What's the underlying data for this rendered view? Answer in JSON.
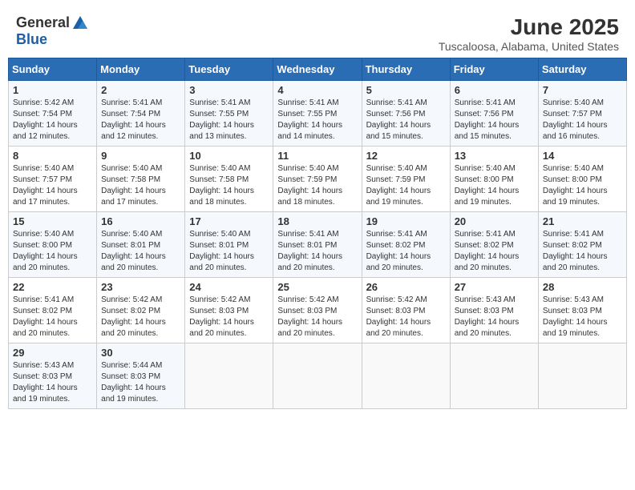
{
  "header": {
    "logo_general": "General",
    "logo_blue": "Blue",
    "title": "June 2025",
    "subtitle": "Tuscaloosa, Alabama, United States"
  },
  "weekdays": [
    "Sunday",
    "Monday",
    "Tuesday",
    "Wednesday",
    "Thursday",
    "Friday",
    "Saturday"
  ],
  "weeks": [
    [
      {
        "day": "1",
        "info": "Sunrise: 5:42 AM\nSunset: 7:54 PM\nDaylight: 14 hours\nand 12 minutes."
      },
      {
        "day": "2",
        "info": "Sunrise: 5:41 AM\nSunset: 7:54 PM\nDaylight: 14 hours\nand 12 minutes."
      },
      {
        "day": "3",
        "info": "Sunrise: 5:41 AM\nSunset: 7:55 PM\nDaylight: 14 hours\nand 13 minutes."
      },
      {
        "day": "4",
        "info": "Sunrise: 5:41 AM\nSunset: 7:55 PM\nDaylight: 14 hours\nand 14 minutes."
      },
      {
        "day": "5",
        "info": "Sunrise: 5:41 AM\nSunset: 7:56 PM\nDaylight: 14 hours\nand 15 minutes."
      },
      {
        "day": "6",
        "info": "Sunrise: 5:41 AM\nSunset: 7:56 PM\nDaylight: 14 hours\nand 15 minutes."
      },
      {
        "day": "7",
        "info": "Sunrise: 5:40 AM\nSunset: 7:57 PM\nDaylight: 14 hours\nand 16 minutes."
      }
    ],
    [
      {
        "day": "8",
        "info": "Sunrise: 5:40 AM\nSunset: 7:57 PM\nDaylight: 14 hours\nand 17 minutes."
      },
      {
        "day": "9",
        "info": "Sunrise: 5:40 AM\nSunset: 7:58 PM\nDaylight: 14 hours\nand 17 minutes."
      },
      {
        "day": "10",
        "info": "Sunrise: 5:40 AM\nSunset: 7:58 PM\nDaylight: 14 hours\nand 18 minutes."
      },
      {
        "day": "11",
        "info": "Sunrise: 5:40 AM\nSunset: 7:59 PM\nDaylight: 14 hours\nand 18 minutes."
      },
      {
        "day": "12",
        "info": "Sunrise: 5:40 AM\nSunset: 7:59 PM\nDaylight: 14 hours\nand 19 minutes."
      },
      {
        "day": "13",
        "info": "Sunrise: 5:40 AM\nSunset: 8:00 PM\nDaylight: 14 hours\nand 19 minutes."
      },
      {
        "day": "14",
        "info": "Sunrise: 5:40 AM\nSunset: 8:00 PM\nDaylight: 14 hours\nand 19 minutes."
      }
    ],
    [
      {
        "day": "15",
        "info": "Sunrise: 5:40 AM\nSunset: 8:00 PM\nDaylight: 14 hours\nand 20 minutes."
      },
      {
        "day": "16",
        "info": "Sunrise: 5:40 AM\nSunset: 8:01 PM\nDaylight: 14 hours\nand 20 minutes."
      },
      {
        "day": "17",
        "info": "Sunrise: 5:40 AM\nSunset: 8:01 PM\nDaylight: 14 hours\nand 20 minutes."
      },
      {
        "day": "18",
        "info": "Sunrise: 5:41 AM\nSunset: 8:01 PM\nDaylight: 14 hours\nand 20 minutes."
      },
      {
        "day": "19",
        "info": "Sunrise: 5:41 AM\nSunset: 8:02 PM\nDaylight: 14 hours\nand 20 minutes."
      },
      {
        "day": "20",
        "info": "Sunrise: 5:41 AM\nSunset: 8:02 PM\nDaylight: 14 hours\nand 20 minutes."
      },
      {
        "day": "21",
        "info": "Sunrise: 5:41 AM\nSunset: 8:02 PM\nDaylight: 14 hours\nand 20 minutes."
      }
    ],
    [
      {
        "day": "22",
        "info": "Sunrise: 5:41 AM\nSunset: 8:02 PM\nDaylight: 14 hours\nand 20 minutes."
      },
      {
        "day": "23",
        "info": "Sunrise: 5:42 AM\nSunset: 8:02 PM\nDaylight: 14 hours\nand 20 minutes."
      },
      {
        "day": "24",
        "info": "Sunrise: 5:42 AM\nSunset: 8:03 PM\nDaylight: 14 hours\nand 20 minutes."
      },
      {
        "day": "25",
        "info": "Sunrise: 5:42 AM\nSunset: 8:03 PM\nDaylight: 14 hours\nand 20 minutes."
      },
      {
        "day": "26",
        "info": "Sunrise: 5:42 AM\nSunset: 8:03 PM\nDaylight: 14 hours\nand 20 minutes."
      },
      {
        "day": "27",
        "info": "Sunrise: 5:43 AM\nSunset: 8:03 PM\nDaylight: 14 hours\nand 20 minutes."
      },
      {
        "day": "28",
        "info": "Sunrise: 5:43 AM\nSunset: 8:03 PM\nDaylight: 14 hours\nand 19 minutes."
      }
    ],
    [
      {
        "day": "29",
        "info": "Sunrise: 5:43 AM\nSunset: 8:03 PM\nDaylight: 14 hours\nand 19 minutes."
      },
      {
        "day": "30",
        "info": "Sunrise: 5:44 AM\nSunset: 8:03 PM\nDaylight: 14 hours\nand 19 minutes."
      },
      {
        "day": "",
        "info": ""
      },
      {
        "day": "",
        "info": ""
      },
      {
        "day": "",
        "info": ""
      },
      {
        "day": "",
        "info": ""
      },
      {
        "day": "",
        "info": ""
      }
    ]
  ]
}
